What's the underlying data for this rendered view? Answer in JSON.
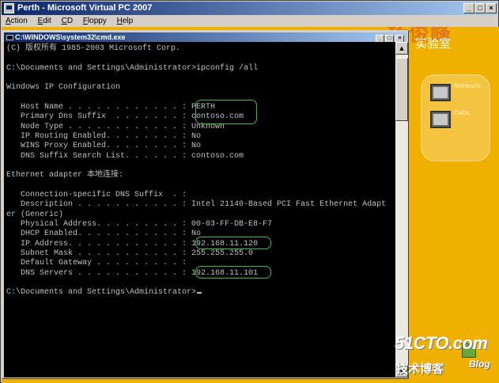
{
  "vpc": {
    "title": "Perth - Microsoft Virtual PC 2007",
    "controls": {
      "minimize": "_",
      "maximize": "□",
      "close": "×"
    },
    "menu": [
      {
        "accel": "A",
        "rest": "ction"
      },
      {
        "accel": "E",
        "rest": "dit"
      },
      {
        "accel": "C",
        "rest": "D"
      },
      {
        "accel": "F",
        "rest": "loppy"
      },
      {
        "accel": "H",
        "rest": "elp"
      }
    ]
  },
  "desktop": {
    "watermark_cn": "杨俊峰",
    "watermark_sub": "实验室",
    "icon_labels": [
      "Network",
      "Data"
    ],
    "brand": "51CTO.com",
    "brand_cn": "技术博客",
    "brand_blog": "Blog"
  },
  "cmd": {
    "title": "C:\\WINDOWS\\system32\\cmd.exe",
    "controls": {
      "minimize": "_",
      "maximize": "□",
      "close": "×"
    },
    "scroll": {
      "up": "▲",
      "down": "▼"
    },
    "lines": [
      "(C) 版权所有 1985-2003 Microsoft Corp.",
      "",
      "C:\\Documents and Settings\\Administrator>ipconfig /all",
      "",
      "Windows IP Configuration",
      "",
      "   Host Name . . . . . . . . . . . . : PERTH",
      "   Primary Dns Suffix  . . . . . . . : contoso.com",
      "   Node Type . . . . . . . . . . . . : Unknown",
      "   IP Routing Enabled. . . . . . . . : No",
      "   WINS Proxy Enabled. . . . . . . . : No",
      "   DNS Suffix Search List. . . . . . : contoso.com",
      "",
      "Ethernet adapter 本地连接:",
      "",
      "   Connection-specific DNS Suffix  . :",
      "   Description . . . . . . . . . . . : Intel 21140-Based PCI Fast Ethernet Adapt",
      "er (Generic)",
      "   Physical Address. . . . . . . . . : 00-03-FF-DB-E8-F7",
      "   DHCP Enabled. . . . . . . . . . . : No",
      "   IP Address. . . . . . . . . . . . : 192.168.11.120",
      "   Subnet Mask . . . . . . . . . . . : 255.255.255.0",
      "   Default Gateway . . . . . . . . . :",
      "   DNS Servers . . . . . . . . . . . : 192.168.11.101",
      "",
      "C:\\Documents and Settings\\Administrator>"
    ]
  },
  "colors": {
    "desktop": "#f0b000",
    "console_bg": "#000000",
    "console_text": "#c0c0c0",
    "highlight": "#3dbb3d",
    "titlebar": "#0a246a"
  }
}
